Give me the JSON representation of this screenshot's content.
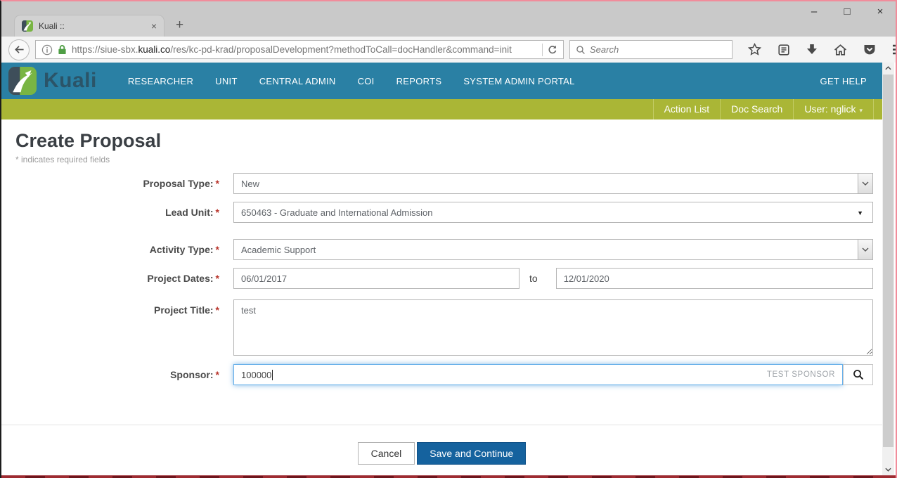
{
  "window": {
    "controls": {
      "minimize": "–",
      "maximize": "□",
      "close": "×"
    }
  },
  "browser": {
    "tab_title": "Kuali ::",
    "tab_close": "×",
    "new_tab": "+",
    "url_pre": "https://siue-sbx.",
    "url_domain": "kuali.co",
    "url_path": "/res/kc-pd-krad/proposalDevelopment?methodToCall=docHandler&command=init",
    "search_placeholder": "Search"
  },
  "header": {
    "brand": "Kuali",
    "nav": [
      "RESEARCHER",
      "UNIT",
      "CENTRAL ADMIN",
      "COI",
      "REPORTS",
      "SYSTEM ADMIN PORTAL"
    ],
    "get_help": "GET HELP"
  },
  "utility": {
    "action_list": "Action List",
    "doc_search": "Doc Search",
    "user": "User: nglick",
    "caret": "▾"
  },
  "page": {
    "title": "Create Proposal",
    "required_note": "* indicates required fields",
    "required_marker": "*"
  },
  "form": {
    "proposal_type_label": "Proposal Type:",
    "proposal_type_value": "New",
    "lead_unit_label": "Lead Unit:",
    "lead_unit_value": "650463 - Graduate and International Admission",
    "lead_unit_caret": "▼",
    "activity_type_label": "Activity Type:",
    "activity_type_value": "Academic Support",
    "project_dates_label": "Project Dates:",
    "project_start": "06/01/2017",
    "dates_separator": "to",
    "project_end": "12/01/2020",
    "project_title_label": "Project Title:",
    "project_title_value": "test",
    "sponsor_label": "Sponsor:",
    "sponsor_value": "100000",
    "sponsor_hint": "TEST SPONSOR"
  },
  "actions": {
    "cancel": "Cancel",
    "save": "Save and Continue"
  },
  "colors": {
    "teal": "#2a80a4",
    "olive_green": "#aab636",
    "primary_button": "#15629e",
    "focus_ring": "#66afe9",
    "asterisk_red": "#b9342b",
    "lock_green": "#4f9e45"
  }
}
